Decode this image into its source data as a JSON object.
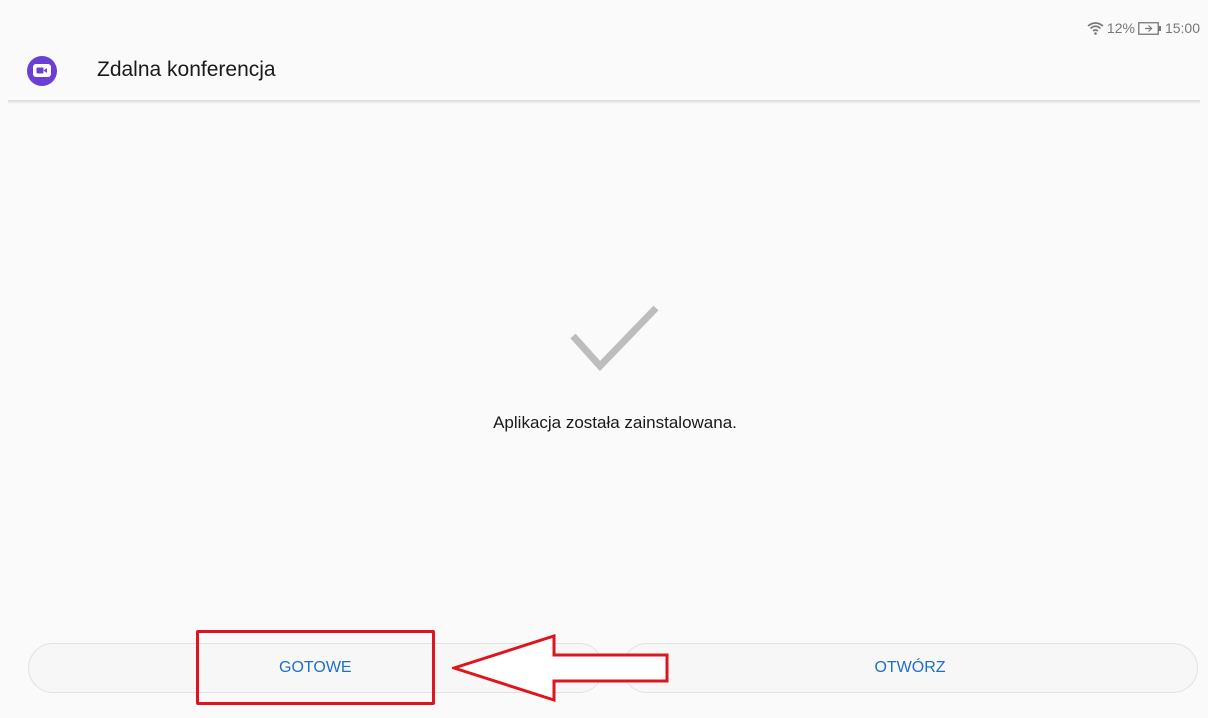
{
  "status_bar": {
    "wifi_icon": "wifi-icon",
    "battery_percent": "12%",
    "battery_icon": "battery-icon",
    "time": "15:00"
  },
  "header": {
    "app_icon": "video-conference-icon",
    "title": "Zdalna konferencja",
    "accent_color": "#6b3fd4"
  },
  "main": {
    "status_icon": "checkmark-icon",
    "message": "Aplikacja została zainstalowana."
  },
  "buttons": {
    "done_label": "GOTOWE",
    "open_label": "OTWÓRZ",
    "label_color": "#1f6fc8"
  },
  "annotation": {
    "highlight_color": "#e0141e",
    "arrow_icon": "left-arrow-icon"
  }
}
